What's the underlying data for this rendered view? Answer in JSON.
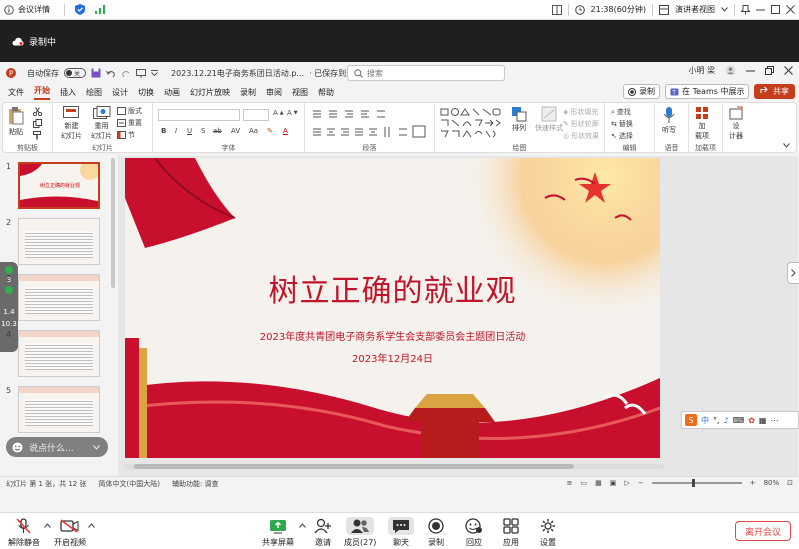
{
  "meeting_top": {
    "title": "会议详情",
    "clock": "21:38(60分钟)",
    "view_mode": "演讲者视图"
  },
  "recording": {
    "label": "录制中"
  },
  "ppt": {
    "autosave_label": "自动保存",
    "autosave_state": "关",
    "file_name": "2023.12.21电子商务系团日活动.p...",
    "save_status": "· 已保存到这台电脑",
    "search_placeholder": "搜索",
    "user": "小明 梁",
    "menu_tabs": [
      "文件",
      "开始",
      "插入",
      "绘图",
      "设计",
      "切换",
      "动画",
      "幻灯片放映",
      "录制",
      "审阅",
      "视图",
      "帮助"
    ],
    "active_tab": "开始",
    "record_btn": "录制",
    "teams_btn": "在 Teams 中展示",
    "share_btn": "共享",
    "ribbon": {
      "paste": "粘贴",
      "clipboard": "剪贴板",
      "new_slide": "新建\n幻灯片",
      "reuse_slide": "重用\n幻灯片",
      "layout": "版式",
      "reset": "重置",
      "section": "节",
      "slides_group": "幻灯片",
      "font_group": "字体",
      "paragraph_group": "段落",
      "arrange": "排列",
      "quick_styles": "快速样式",
      "shape_fill": "形状填充",
      "shape_outline": "形状轮廓",
      "shape_effects": "形状效果",
      "drawing_group": "绘图",
      "find": "查找",
      "replace": "替换",
      "select": "选择",
      "editing_group": "编辑",
      "dictate": "听写",
      "voice_group": "语音",
      "addins": "加\n载项",
      "addins_group": "加载项",
      "designer": "设\n计器"
    },
    "thumbs": [
      {
        "num": "1",
        "title": "树立正确的就业观"
      },
      {
        "num": "2"
      },
      {
        "num": "3"
      },
      {
        "num": "4"
      },
      {
        "num": "5"
      }
    ],
    "slide": {
      "title": "树立正确的就业观",
      "subtitle": "2023年度共青团电子商务系学生会支部委员会主题团日活动",
      "date": "2023年12月24日"
    },
    "status": {
      "slide_info": "幻灯片 第 1 张，共 12 张",
      "language": "简体中文(中国大陆)",
      "accessibility": "辅助功能: 调查",
      "zoom": "80%"
    }
  },
  "overlays": {
    "side_values": [
      "3",
      "1.4",
      "10.3"
    ],
    "chat_placeholder": "说点什么..."
  },
  "meeting_bottom": {
    "mute": "解除静音",
    "video": "开启视频",
    "share_screen": "共享屏幕",
    "invite": "邀请",
    "members": "成员(27)",
    "chat": "聊天",
    "record": "录制",
    "reaction": "回应",
    "apps": "应用",
    "settings": "设置",
    "leave": "离开会议"
  }
}
